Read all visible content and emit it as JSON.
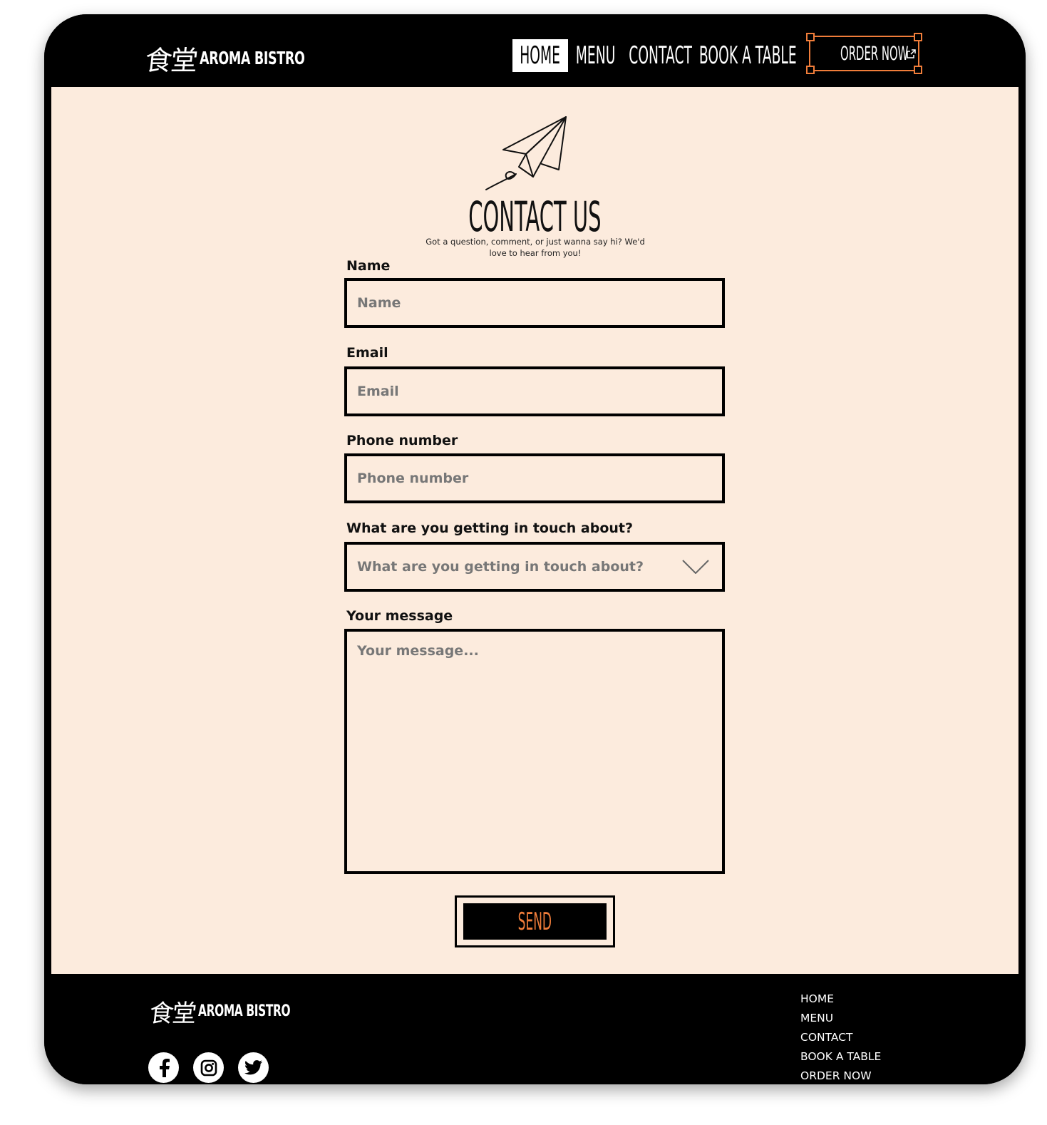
{
  "brand": {
    "kanji": "食堂",
    "name": "AROMA BISTRO"
  },
  "nav": {
    "items": [
      "HOME",
      "MENU",
      "CONTACT",
      "BOOK A TABLE"
    ],
    "active": "HOME",
    "order_label": "ORDER NOW",
    "order_icon": "external-link-icon"
  },
  "contact": {
    "title": "CONTACT US",
    "subtitle": "Got a question, comment, or just wanna say hi? We'd love to hear from you!",
    "fields": [
      {
        "label": "Name",
        "placeholder": "Name"
      },
      {
        "label": "Email",
        "placeholder": "Email"
      },
      {
        "label": "Phone number",
        "placeholder": "Phone number"
      },
      {
        "label": "What are you getting in touch about?",
        "placeholder": "What are you getting in touch about?"
      },
      {
        "label": "Your message",
        "placeholder": "Your message..."
      }
    ],
    "send_label": "SEND"
  },
  "footer": {
    "links": [
      "HOME",
      "MENU",
      "CONTACT",
      "BOOK A TABLE",
      "ORDER NOW"
    ],
    "socials": [
      "facebook-icon",
      "instagram-icon",
      "twitter-icon"
    ]
  },
  "colors": {
    "accent": "#f07d3a",
    "background": "#fcebdd",
    "frame": "#000000"
  }
}
